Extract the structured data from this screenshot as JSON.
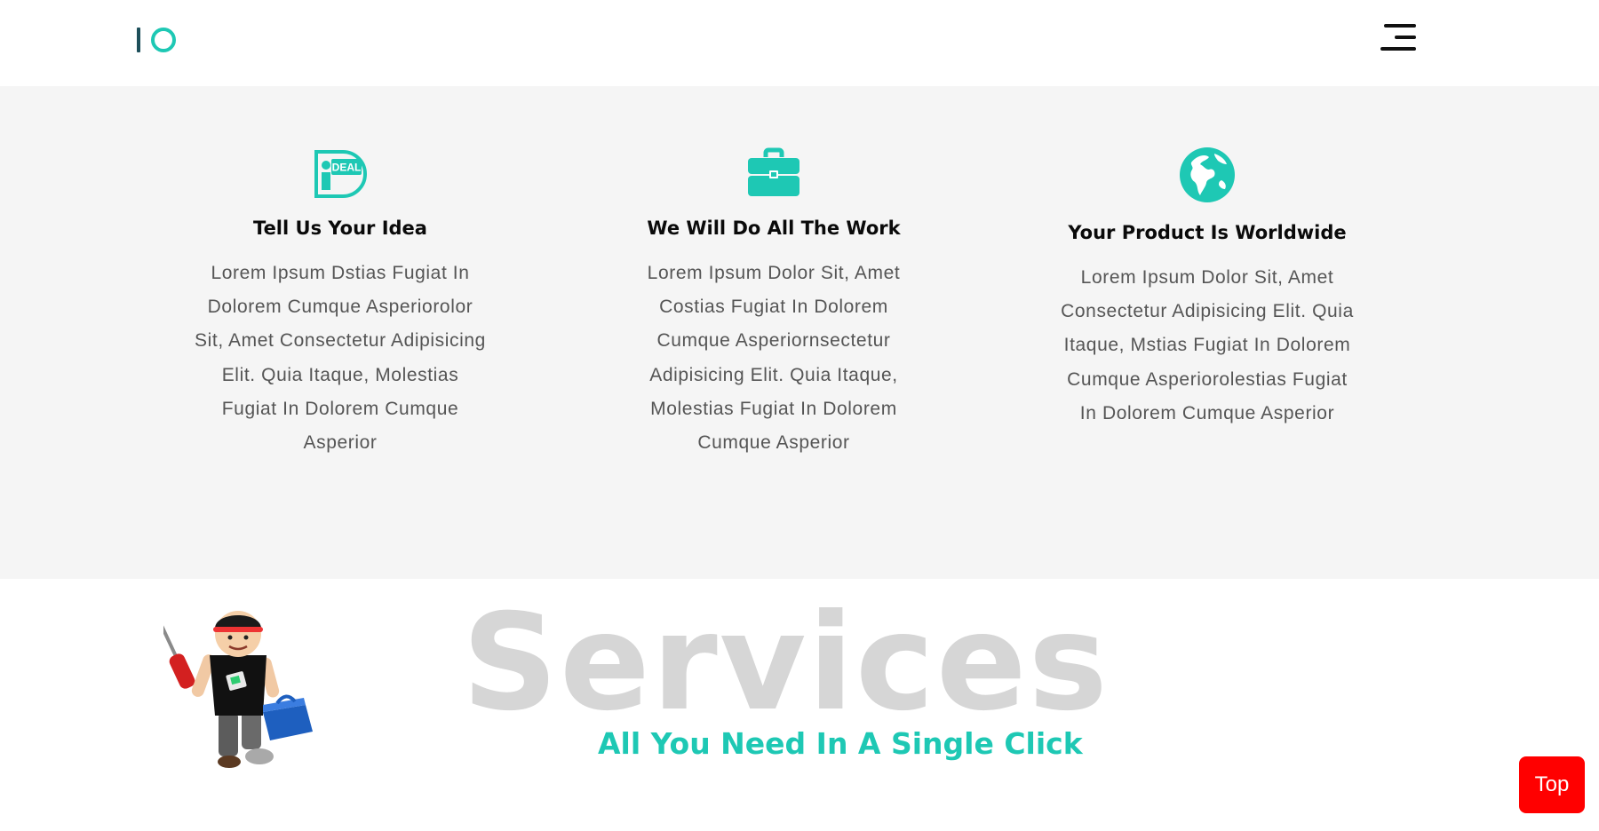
{
  "header": {
    "logo_icon": "io-logo-icon",
    "menu_icon": "hamburger-menu-icon"
  },
  "features": [
    {
      "icon": "ideal-icon",
      "icon_text": "DEAL",
      "title": "Tell Us Your Idea",
      "text": "Lorem Ipsum Dstias Fugiat In Dolorem Cumque Asperiorolor Sit, Amet Consectetur Adipisicing Elit. Quia Itaque, Molestias Fugiat In Dolorem Cumque Asperior"
    },
    {
      "icon": "briefcase-icon",
      "title": "We Will Do All The Work",
      "text": "Lorem Ipsum Dolor Sit, Amet Costias Fugiat In Dolorem Cumque Asperiornsectetur Adipisicing Elit. Quia Itaque, Molestias Fugiat In Dolorem Cumque Asperior"
    },
    {
      "icon": "globe-icon",
      "title": "Your Product Is Worldwide",
      "text": "Lorem Ipsum Dolor Sit, Amet Consectetur Adipisicing Elit. Quia Itaque, Mstias Fugiat In Dolorem Cumque Asperiorolestias Fugiat In Dolorem Cumque Asperior"
    }
  ],
  "services": {
    "heading": "Services",
    "subheading": "All You Need In A Single Click",
    "mascot": "handyman-mascot-illustration"
  },
  "top_button": {
    "label": "Top"
  },
  "colors": {
    "accent": "#1ec8b4",
    "section_bg": "#f5f5f5",
    "body_text": "#555555",
    "heading_watermark": "#d6d6d6",
    "top_button": "#ff0000"
  }
}
